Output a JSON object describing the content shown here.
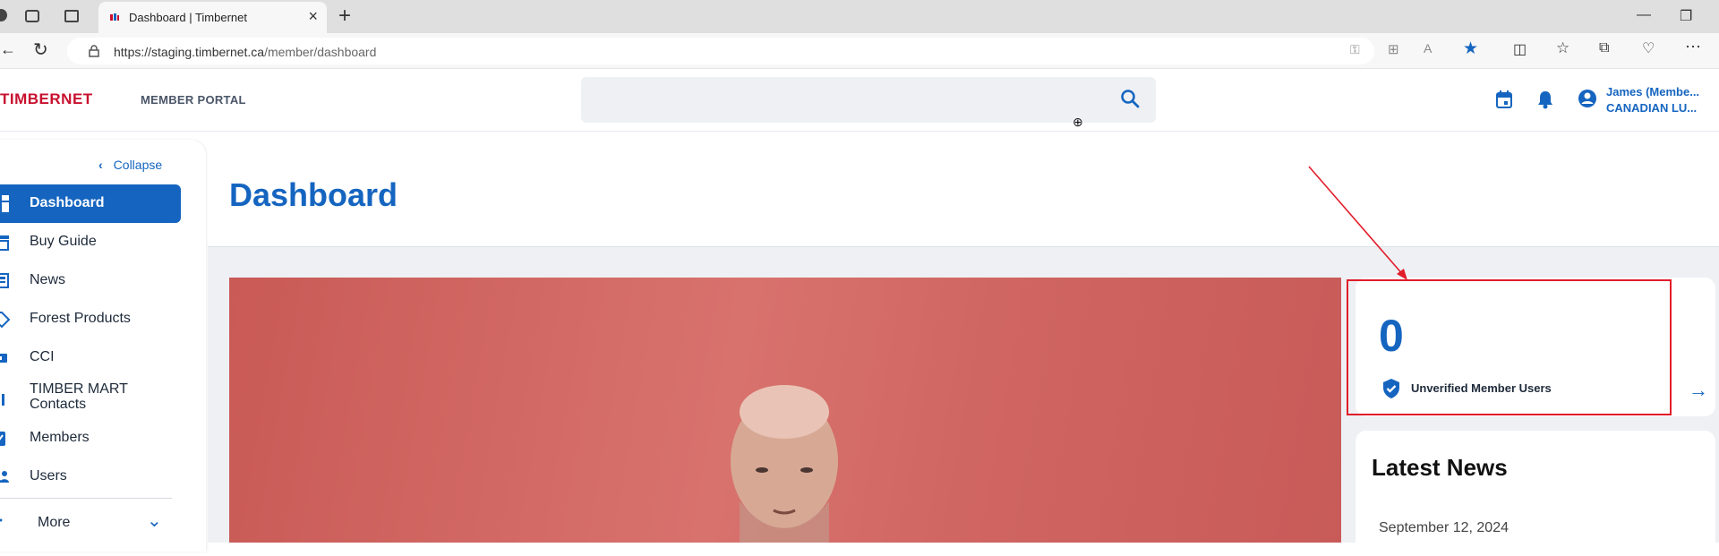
{
  "browser": {
    "tab_title": "Dashboard | Timbernet",
    "url_host": "https://staging.timbernet.ca",
    "url_path": "/member/dashboard"
  },
  "header": {
    "brand": "TIMBERNET",
    "portal_label": "MEMBER PORTAL",
    "search_placeholder": "",
    "user_name": "James (Membe...",
    "user_org": "CANADIAN LU..."
  },
  "sidebar": {
    "collapse_label": "Collapse",
    "items": [
      {
        "label": "Dashboard"
      },
      {
        "label": "Buy Guide"
      },
      {
        "label": "News"
      },
      {
        "label": "Forest Products"
      },
      {
        "label": "CCI"
      },
      {
        "label": "TIMBER MART Contacts"
      },
      {
        "label": "Members"
      },
      {
        "label": "Users"
      }
    ],
    "more_label": "More"
  },
  "main": {
    "page_title": "Dashboard",
    "unverified": {
      "count": "0",
      "label": "Unverified Member Users"
    },
    "news": {
      "title": "Latest News",
      "date": "September 12, 2024"
    }
  },
  "colors": {
    "accent": "#1565c0",
    "highlight": "#e11d2a",
    "brand_red": "#c8102e"
  }
}
